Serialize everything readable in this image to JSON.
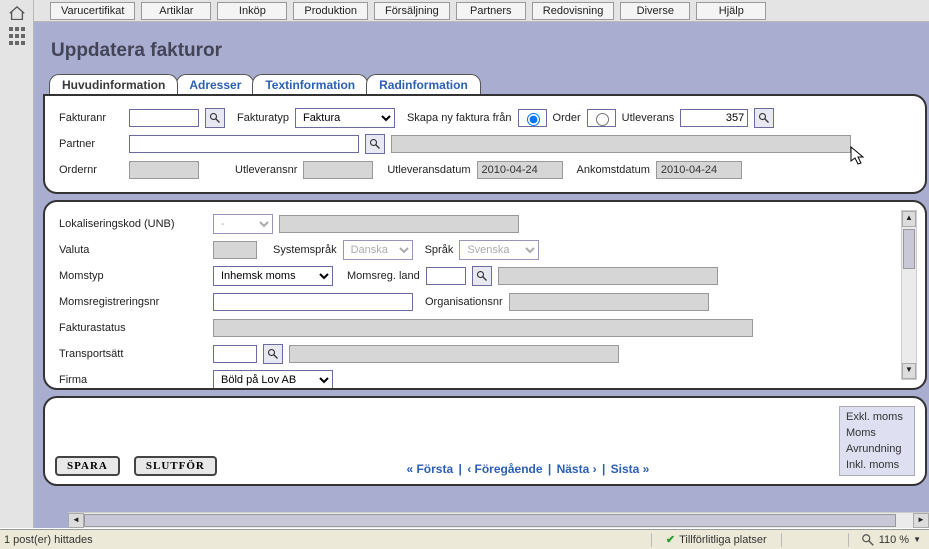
{
  "menu": [
    "Varucertifikat",
    "Artiklar",
    "Inköp",
    "Produktion",
    "Försäljning",
    "Partners",
    "Redovisning",
    "Diverse",
    "Hjälp"
  ],
  "title": "Uppdatera fakturor",
  "tabs": {
    "main": "Huvudinformation",
    "addresses": "Adresser",
    "textinfo": "Textinformation",
    "lineinfo": "Radinformation"
  },
  "fields": {
    "fakturanr": "Fakturanr",
    "fakturatyp": "Fakturatyp",
    "fakturatyp_value": "Faktura",
    "skapa_fran": "Skapa ny faktura från",
    "order": "Order",
    "utleverans": "Utleverans",
    "utleverans_value": "357",
    "partner": "Partner",
    "ordernr": "Ordernr",
    "utleveransnr": "Utleveransnr",
    "utleveransdatum": "Utleveransdatum",
    "utleveransdatum_value": "2010-04-24",
    "ankomstdatum": "Ankomstdatum",
    "ankomstdatum_value": "2010-04-24",
    "lokaliseringskod": "Lokaliseringskod (UNB)",
    "lokaliseringskod_value": "-",
    "valuta": "Valuta",
    "systemsprak": "Systemspråk",
    "systemsprak_value": "Danska",
    "sprak": "Språk",
    "sprak_value": "Svenska",
    "momstyp": "Momstyp",
    "momstyp_value": "Inhemsk moms",
    "momsreg_land": "Momsreg. land",
    "momsregnr": "Momsregistreringsnr",
    "organisationsnr": "Organisationsnr",
    "fakturastatus": "Fakturastatus",
    "transportsatt": "Transportsätt",
    "firma": "Firma",
    "firma_value": "Böld på Lov AB"
  },
  "buttons": {
    "save": "SPARA",
    "finish": "SLUTFÖR"
  },
  "pager": {
    "first": "« Första",
    "prev": "‹ Föregående",
    "next": "Nästa ›",
    "last": "Sista »"
  },
  "tax": {
    "excl": "Exkl. moms",
    "moms": "Moms",
    "round": "Avrundning",
    "incl": "Inkl. moms"
  },
  "status": {
    "posts": "1 post(er) hittades",
    "trusted": "Tillförlitliga platser",
    "zoom": "110 %"
  }
}
